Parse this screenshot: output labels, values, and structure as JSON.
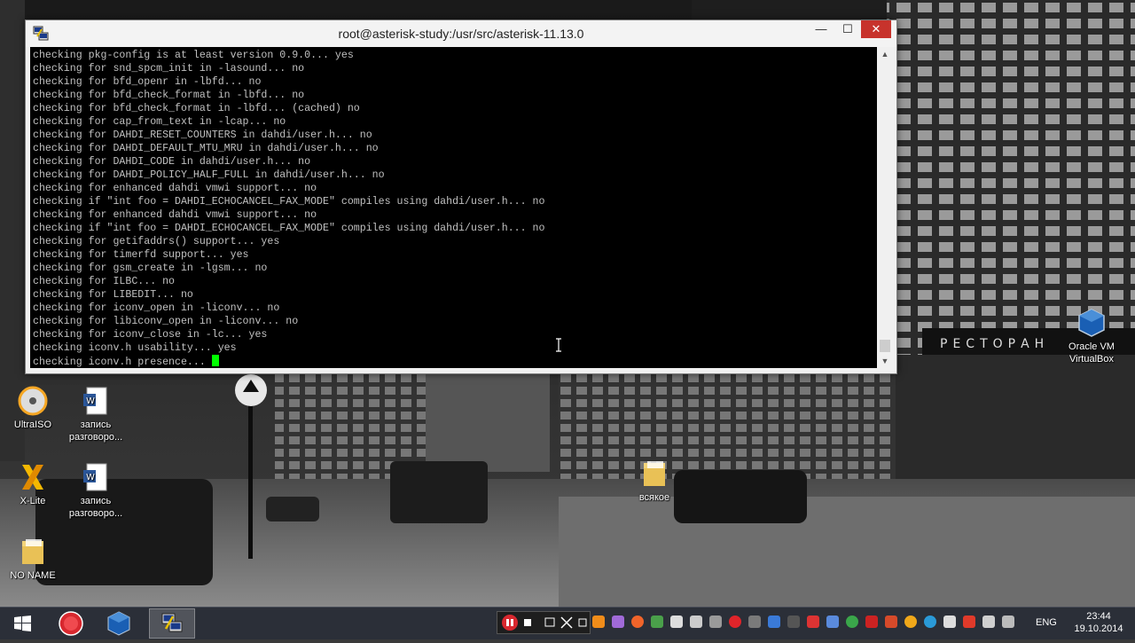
{
  "window": {
    "title": "root@asterisk-study:/usr/src/asterisk-11.13.0",
    "minimize": "—",
    "maximize": "☐",
    "close": "✕"
  },
  "terminal": {
    "lines": [
      "checking pkg-config is at least version 0.9.0... yes",
      "checking for snd_spcm_init in -lasound... no",
      "checking for bfd_openr in -lbfd... no",
      "checking for bfd_check_format in -lbfd... no",
      "checking for bfd_check_format in -lbfd... (cached) no",
      "checking for cap_from_text in -lcap... no",
      "checking for DAHDI_RESET_COUNTERS in dahdi/user.h... no",
      "checking for DAHDI_DEFAULT_MTU_MRU in dahdi/user.h... no",
      "checking for DAHDI_CODE in dahdi/user.h... no",
      "checking for DAHDI_POLICY_HALF_FULL in dahdi/user.h... no",
      "checking for enhanced dahdi vmwi support... no",
      "checking if \"int foo = DAHDI_ECHOCANCEL_FAX_MODE\" compiles using dahdi/user.h... no",
      "checking for enhanced dahdi vmwi support... no",
      "checking if \"int foo = DAHDI_ECHOCANCEL_FAX_MODE\" compiles using dahdi/user.h... no",
      "checking for getifaddrs() support... yes",
      "checking for timerfd support... yes",
      "checking for gsm_create in -lgsm... no",
      "checking for ILBC... no",
      "checking for LIBEDIT... no",
      "checking for iconv_open in -liconv... no",
      "checking for libiconv_open in -liconv... no",
      "checking for iconv_close in -lc... yes",
      "checking iconv.h usability... yes",
      "checking iconv.h presence... "
    ]
  },
  "desktop_icons": {
    "ultraiso": "UltraISO",
    "doc1": "запись разговоро...",
    "xlite": "X-Lite",
    "doc2": "запись разговоро...",
    "noname": "NO NAME",
    "virtualbox": "Oracle VM VirtualBox",
    "folder": "всякое"
  },
  "taskbar": {
    "language": "ENG",
    "time": "23:44",
    "date": "19.10.2014"
  },
  "colors": {
    "terminal_bg": "#000000",
    "terminal_fg": "#c0c0c0",
    "cursor": "#00ff00",
    "close_button": "#c7332c",
    "taskbar": "#2b2f38"
  }
}
